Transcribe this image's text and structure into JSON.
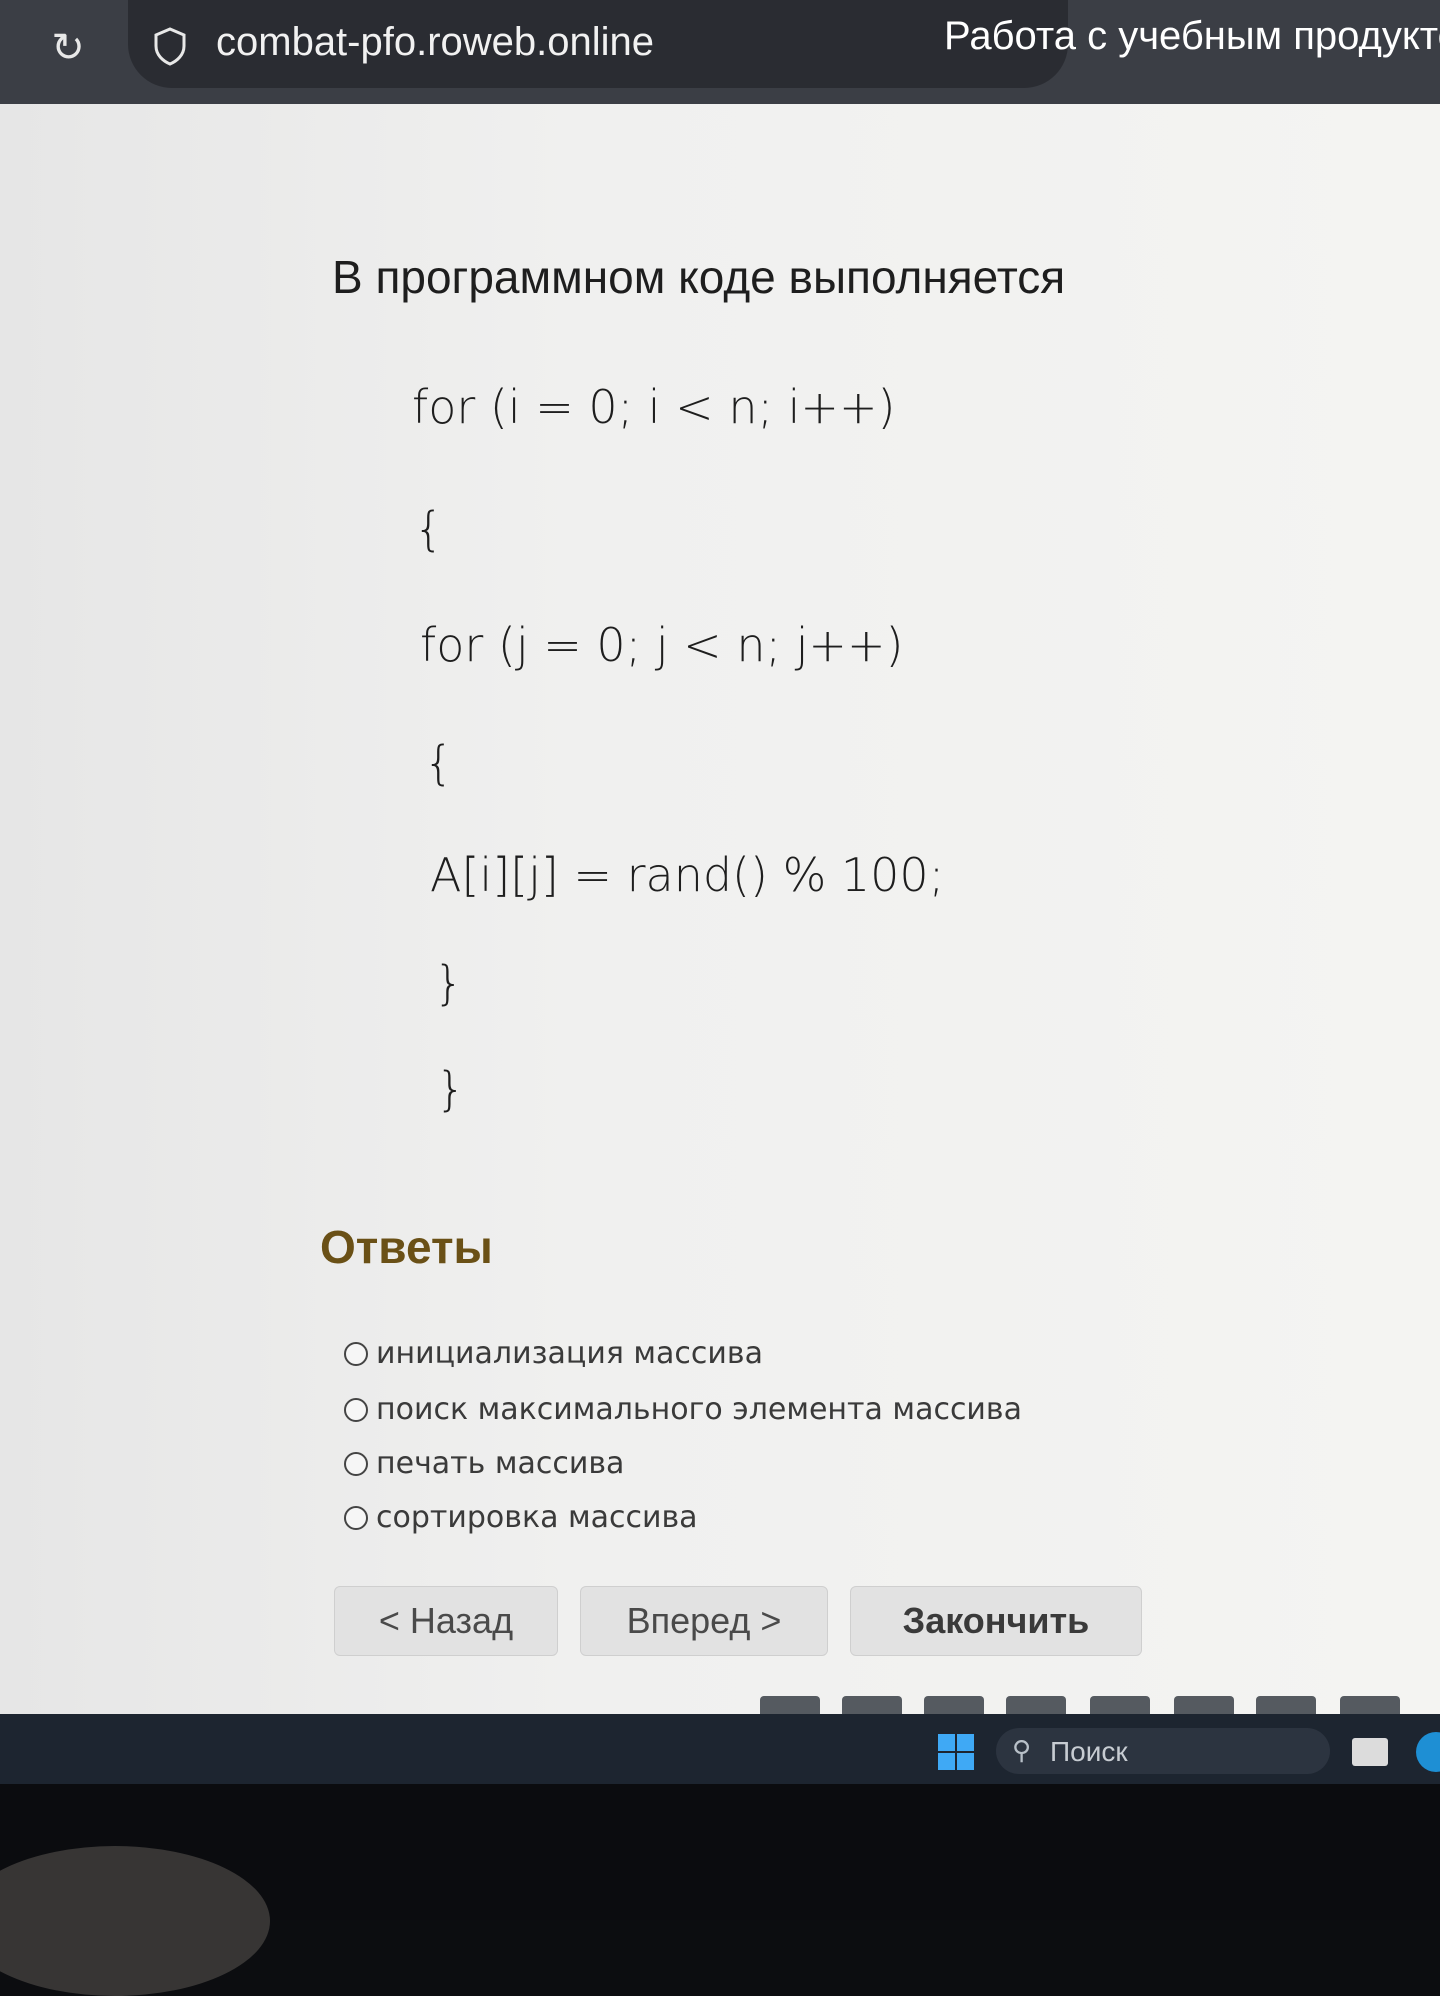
{
  "browser": {
    "url": "combat-pfo.roweb.online",
    "tab_title": "Работа с учебным продукто"
  },
  "question": {
    "text": "В программном коде выполняется",
    "code_lines": [
      "for (i = 0; i < n; i++)",
      "{",
      "for (j = 0; j < n; j++)",
      "{",
      "A[i][j] = rand() % 100;",
      "}",
      "}"
    ]
  },
  "answers": {
    "title": "Ответы",
    "options": [
      "инициализация массива",
      "поиск максимального элемента массива",
      "печать массива",
      "сортировка массива"
    ]
  },
  "nav": {
    "back": "< Назад",
    "forward": "Вперед >",
    "finish": "Закончить"
  },
  "taskbar": {
    "search_placeholder": "Поиск"
  }
}
